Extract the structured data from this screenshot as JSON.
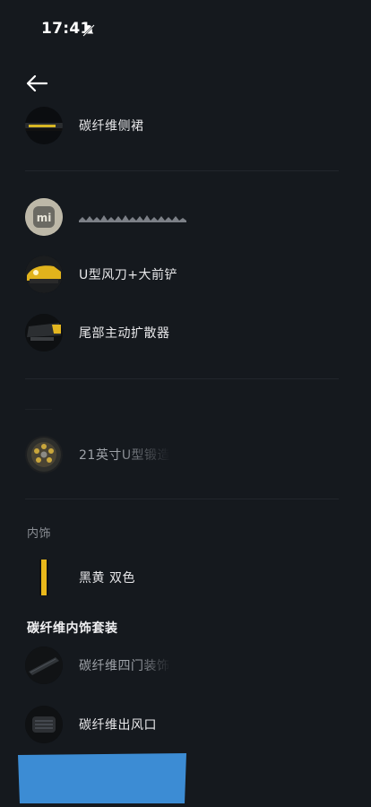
{
  "status_bar": {
    "time": "17:41"
  },
  "items": [
    {
      "id": "carbon-side-skirt",
      "label": "碳纤维侧裙"
    },
    {
      "id": "redacted-item",
      "label": ""
    },
    {
      "id": "u-spoiler",
      "label": "U型风刀+大前铲"
    },
    {
      "id": "rear-diffuser",
      "label": "尾部主动扩散器"
    },
    {
      "id": "wheel-21",
      "label": "21英寸U型锻造"
    },
    {
      "id": "interior-color",
      "label": "黑黄 双色"
    },
    {
      "id": "carbon-door-trim",
      "label": "碳纤维四门装饰"
    },
    {
      "id": "carbon-vent",
      "label": "碳纤维出风口"
    }
  ],
  "sections": {
    "interior": "内饰",
    "carbon_interior_kit": "碳纤维内饰套装"
  },
  "colors": {
    "background": "#15191e",
    "accent_yellow": "#e9b81b",
    "redaction_blue": "#3c8cd4"
  }
}
